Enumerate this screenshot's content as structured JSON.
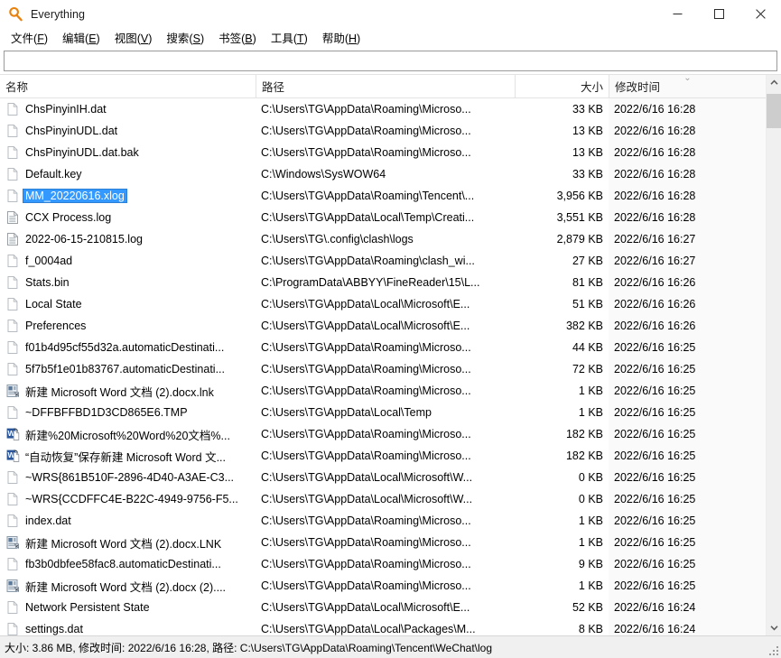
{
  "window": {
    "title": "Everything",
    "icon": "magnifier-icon",
    "minimize_label": "─",
    "maximize_label": "□",
    "close_label": "✕"
  },
  "menubar": [
    {
      "name": "file",
      "text": "文件",
      "accel": "F"
    },
    {
      "name": "edit",
      "text": "编辑",
      "accel": "E"
    },
    {
      "name": "view",
      "text": "视图",
      "accel": "V"
    },
    {
      "name": "search",
      "text": "搜索",
      "accel": "S"
    },
    {
      "name": "bookmarks",
      "text": "书签",
      "accel": "B"
    },
    {
      "name": "tools",
      "text": "工具",
      "accel": "T"
    },
    {
      "name": "help",
      "text": "帮助",
      "accel": "H"
    }
  ],
  "search": {
    "value": "",
    "placeholder": ""
  },
  "columns": {
    "name": "名称",
    "path": "路径",
    "size": "大小",
    "date": "修改时间",
    "sort_column": "修改时间",
    "sort_direction": "descending",
    "sort_glyph": "⌄"
  },
  "rows": [
    {
      "icon": "generic-file-icon",
      "name": "ChsPinyinIH.dat",
      "path": "C:\\Users\\TG\\AppData\\Roaming\\Microso...",
      "size": "33 KB",
      "date": "2022/6/16 16:28",
      "selected": false
    },
    {
      "icon": "generic-file-icon",
      "name": "ChsPinyinUDL.dat",
      "path": "C:\\Users\\TG\\AppData\\Roaming\\Microso...",
      "size": "13 KB",
      "date": "2022/6/16 16:28",
      "selected": false
    },
    {
      "icon": "generic-file-icon",
      "name": "ChsPinyinUDL.dat.bak",
      "path": "C:\\Users\\TG\\AppData\\Roaming\\Microso...",
      "size": "13 KB",
      "date": "2022/6/16 16:28",
      "selected": false
    },
    {
      "icon": "generic-file-icon",
      "name": "Default.key",
      "path": "C:\\Windows\\SysWOW64",
      "size": "33 KB",
      "date": "2022/6/16 16:28",
      "selected": false
    },
    {
      "icon": "generic-file-icon",
      "name": "MM_20220616.xlog",
      "path": "C:\\Users\\TG\\AppData\\Roaming\\Tencent\\...",
      "size": "3,956 KB",
      "date": "2022/6/16 16:28",
      "selected": true
    },
    {
      "icon": "log-file-icon",
      "name": "CCX Process.log",
      "path": "C:\\Users\\TG\\AppData\\Local\\Temp\\Creati...",
      "size": "3,551 KB",
      "date": "2022/6/16 16:28",
      "selected": false
    },
    {
      "icon": "log-file-icon",
      "name": "2022-06-15-210815.log",
      "path": "C:\\Users\\TG\\.config\\clash\\logs",
      "size": "2,879 KB",
      "date": "2022/6/16 16:27",
      "selected": false
    },
    {
      "icon": "generic-file-icon",
      "name": "f_0004ad",
      "path": "C:\\Users\\TG\\AppData\\Roaming\\clash_wi...",
      "size": "27 KB",
      "date": "2022/6/16 16:27",
      "selected": false
    },
    {
      "icon": "generic-file-icon",
      "name": "Stats.bin",
      "path": "C:\\ProgramData\\ABBYY\\FineReader\\15\\L...",
      "size": "81 KB",
      "date": "2022/6/16 16:26",
      "selected": false
    },
    {
      "icon": "generic-file-icon",
      "name": "Local State",
      "path": "C:\\Users\\TG\\AppData\\Local\\Microsoft\\E...",
      "size": "51 KB",
      "date": "2022/6/16 16:26",
      "selected": false
    },
    {
      "icon": "generic-file-icon",
      "name": "Preferences",
      "path": "C:\\Users\\TG\\AppData\\Local\\Microsoft\\E...",
      "size": "382 KB",
      "date": "2022/6/16 16:26",
      "selected": false
    },
    {
      "icon": "generic-file-icon",
      "name": "f01b4d95cf55d32a.automaticDestinati...",
      "path": "C:\\Users\\TG\\AppData\\Roaming\\Microso...",
      "size": "44 KB",
      "date": "2022/6/16 16:25",
      "selected": false
    },
    {
      "icon": "generic-file-icon",
      "name": "5f7b5f1e01b83767.automaticDestinati...",
      "path": "C:\\Users\\TG\\AppData\\Roaming\\Microso...",
      "size": "72 KB",
      "date": "2022/6/16 16:25",
      "selected": false
    },
    {
      "icon": "shortcut-lnk-icon",
      "name": "新建 Microsoft Word 文档 (2).docx.lnk",
      "path": "C:\\Users\\TG\\AppData\\Roaming\\Microso...",
      "size": "1 KB",
      "date": "2022/6/16 16:25",
      "selected": false
    },
    {
      "icon": "generic-file-icon",
      "name": "~DFFBFFBD1D3CD865E6.TMP",
      "path": "C:\\Users\\TG\\AppData\\Local\\Temp",
      "size": "1 KB",
      "date": "2022/6/16 16:25",
      "selected": false
    },
    {
      "icon": "word-shortcut-icon",
      "name": "新建%20Microsoft%20Word%20文档%...",
      "path": "C:\\Users\\TG\\AppData\\Roaming\\Microso...",
      "size": "182 KB",
      "date": "2022/6/16 16:25",
      "selected": false
    },
    {
      "icon": "word-shortcut-icon",
      "name": "“自动恢复”保存新建 Microsoft Word 文...",
      "path": "C:\\Users\\TG\\AppData\\Roaming\\Microso...",
      "size": "182 KB",
      "date": "2022/6/16 16:25",
      "selected": false
    },
    {
      "icon": "generic-file-icon",
      "name": "~WRS{861B510F-2896-4D40-A3AE-C3...",
      "path": "C:\\Users\\TG\\AppData\\Local\\Microsoft\\W...",
      "size": "0 KB",
      "date": "2022/6/16 16:25",
      "selected": false
    },
    {
      "icon": "generic-file-icon",
      "name": "~WRS{CCDFFC4E-B22C-4949-9756-F5...",
      "path": "C:\\Users\\TG\\AppData\\Local\\Microsoft\\W...",
      "size": "0 KB",
      "date": "2022/6/16 16:25",
      "selected": false
    },
    {
      "icon": "generic-file-icon",
      "name": "index.dat",
      "path": "C:\\Users\\TG\\AppData\\Roaming\\Microso...",
      "size": "1 KB",
      "date": "2022/6/16 16:25",
      "selected": false
    },
    {
      "icon": "shortcut-lnk-icon",
      "name": "新建 Microsoft Word 文档 (2).docx.LNK",
      "path": "C:\\Users\\TG\\AppData\\Roaming\\Microso...",
      "size": "1 KB",
      "date": "2022/6/16 16:25",
      "selected": false
    },
    {
      "icon": "generic-file-icon",
      "name": "fb3b0dbfee58fac8.automaticDestinati...",
      "path": "C:\\Users\\TG\\AppData\\Roaming\\Microso...",
      "size": "9 KB",
      "date": "2022/6/16 16:25",
      "selected": false
    },
    {
      "icon": "shortcut-lnk-icon",
      "name": "新建 Microsoft Word 文档 (2).docx (2)....",
      "path": "C:\\Users\\TG\\AppData\\Roaming\\Microso...",
      "size": "1 KB",
      "date": "2022/6/16 16:25",
      "selected": false
    },
    {
      "icon": "generic-file-icon",
      "name": "Network Persistent State",
      "path": "C:\\Users\\TG\\AppData\\Local\\Microsoft\\E...",
      "size": "52 KB",
      "date": "2022/6/16 16:24",
      "selected": false
    },
    {
      "icon": "generic-file-icon",
      "name": "settings.dat",
      "path": "C:\\Users\\TG\\AppData\\Local\\Packages\\M...",
      "size": "8 KB",
      "date": "2022/6/16 16:24",
      "selected": false
    }
  ],
  "statusbar": {
    "text": "大小: 3.86 MB, 修改时间: 2022/6/16 16:28, 路径: C:\\Users\\TG\\AppData\\Roaming\\Tencent\\WeChat\\log"
  },
  "scrollbar": {
    "up_glyph": "⌃",
    "down_glyph": "⌄"
  },
  "colors": {
    "accent": "#3399ff",
    "icon_orange": "#e8820c",
    "word_blue": "#2b579a",
    "status_bg": "#f0f0f0"
  }
}
